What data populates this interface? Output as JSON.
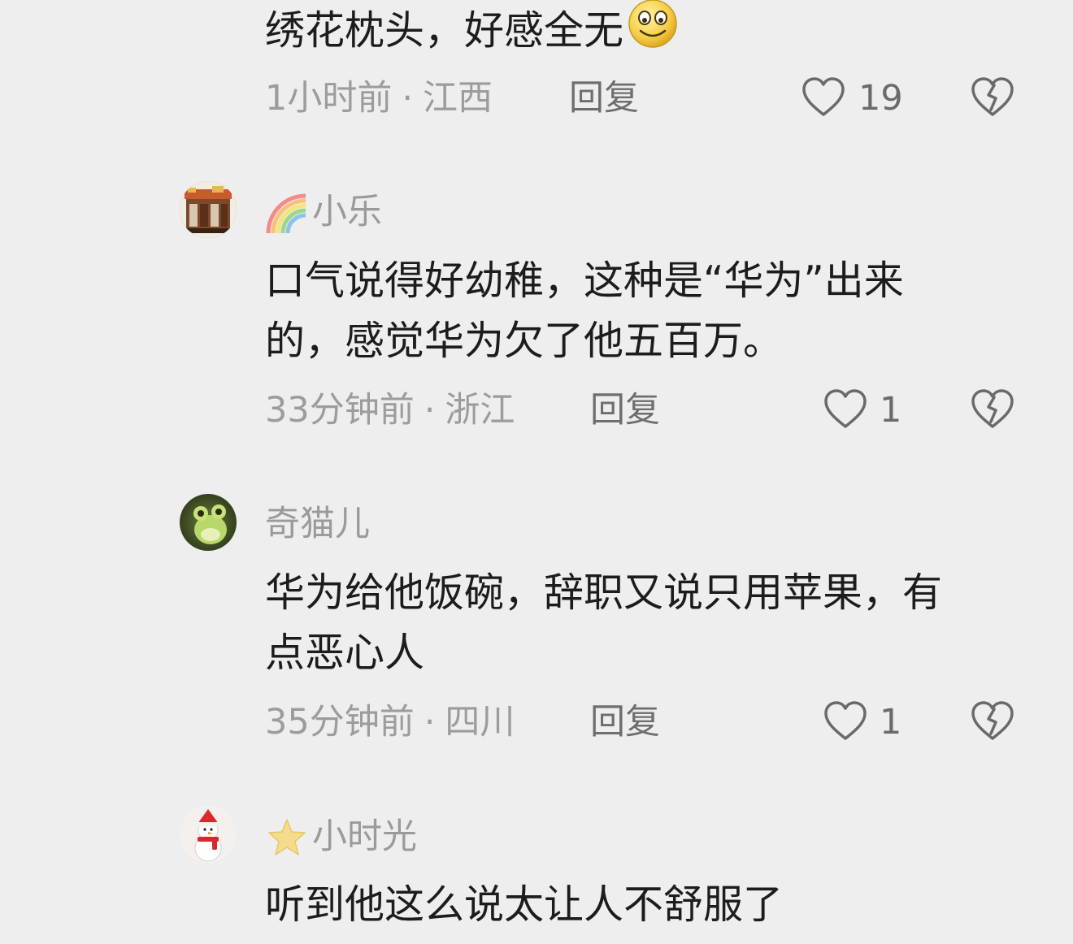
{
  "comments": [
    {
      "text_lines": [
        "绣花枕头，好感全无"
      ],
      "time": "1小时前",
      "location": "江西",
      "reply_label": "回复",
      "likes": "19"
    },
    {
      "username": "小乐",
      "badge_icon": "rainbow-icon",
      "avatar_icon": "storefront-avatar",
      "text_lines": [
        "口气说得好幼稚，这种是“华为”出来",
        "的，感觉华为欠了他五百万。"
      ],
      "time": "33分钟前",
      "location": "浙江",
      "reply_label": "回复",
      "likes": "1"
    },
    {
      "username": "奇猫儿",
      "avatar_icon": "frog-avatar",
      "text_lines": [
        "华为给他饭碗，辞职又说只用苹果，有",
        "点恶心人"
      ],
      "time": "35分钟前",
      "location": "四川",
      "reply_label": "回复",
      "likes": "1"
    },
    {
      "username": "小时光",
      "badge_icon": "star-icon",
      "avatar_icon": "snowman-avatar",
      "text_lines": [
        "听到他这么说太让人不舒服了"
      ]
    }
  ],
  "separator": "·",
  "icons": {
    "like": "heart-outline-icon",
    "dislike": "broken-heart-icon",
    "emoji": "smiley-emoji-icon"
  },
  "colors": {
    "background": "#eeeeef",
    "text": "#1c1c1c",
    "meta": "#9c9c9c",
    "icon": "#6a6a6a"
  }
}
